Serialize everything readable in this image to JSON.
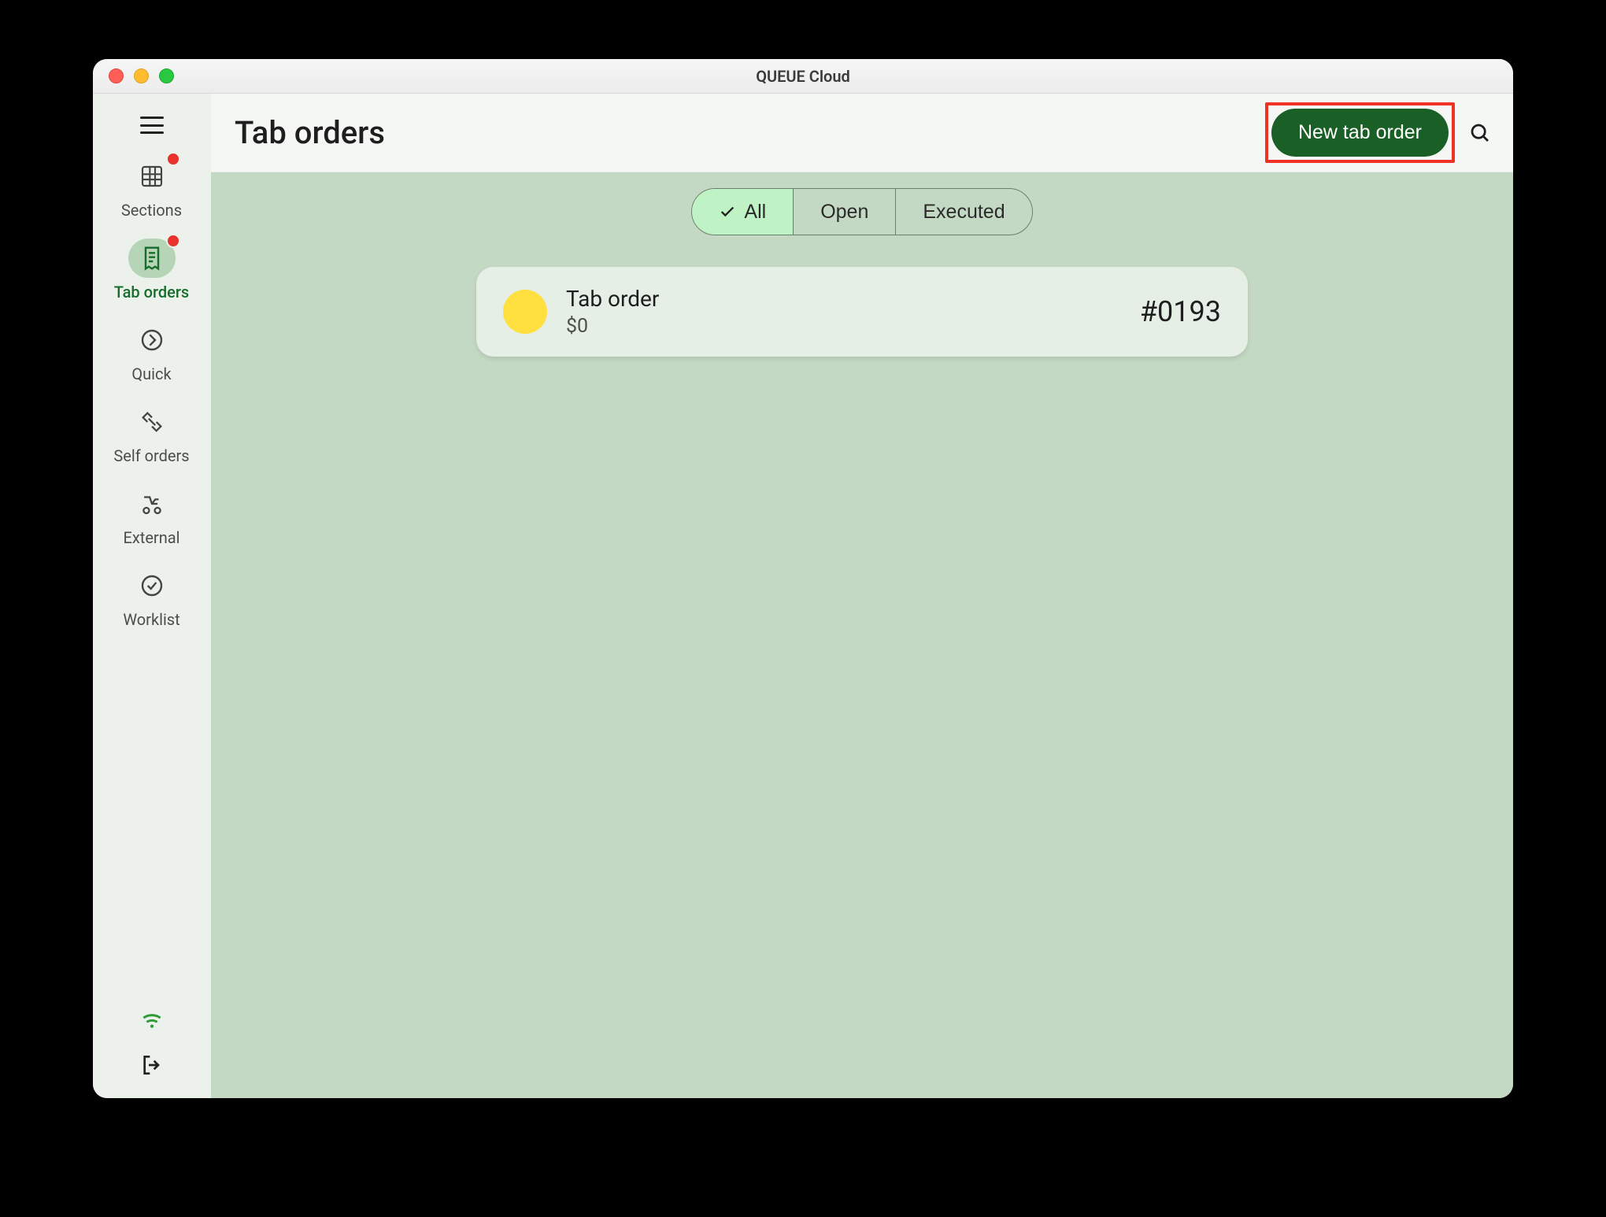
{
  "window_title": "QUEUE Cloud",
  "page_title": "Tab orders",
  "new_button_label": "New tab order",
  "sidebar": {
    "items": [
      {
        "key": "sections",
        "label": "Sections",
        "badge": true
      },
      {
        "key": "tab-orders",
        "label": "Tab orders",
        "badge": true
      },
      {
        "key": "quick",
        "label": "Quick",
        "badge": false
      },
      {
        "key": "self-orders",
        "label": "Self orders",
        "badge": false
      },
      {
        "key": "external",
        "label": "External",
        "badge": false
      },
      {
        "key": "worklist",
        "label": "Worklist",
        "badge": false
      }
    ]
  },
  "filters": {
    "all": "All",
    "open": "Open",
    "executed": "Executed",
    "selected": "all"
  },
  "orders": [
    {
      "title": "Tab order",
      "amount": "$0",
      "id": "#0193",
      "status_color": "#ffe03e"
    }
  ]
}
